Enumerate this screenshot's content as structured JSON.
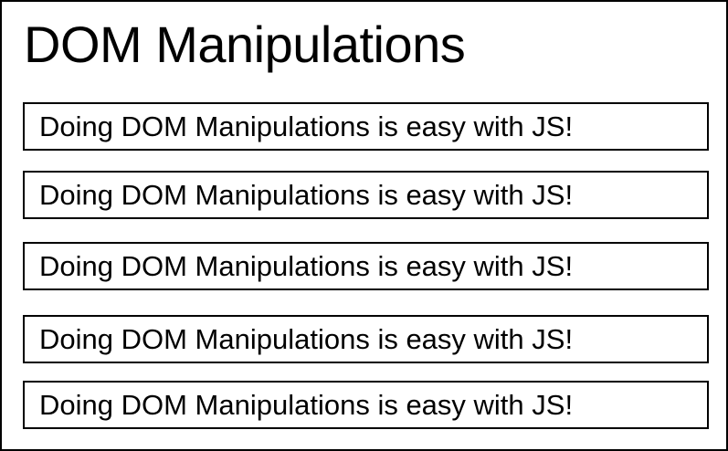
{
  "page": {
    "heading": "DOM Manipulations"
  },
  "paragraphs": [
    {
      "text": "Doing DOM Manipulations is easy with JS!"
    },
    {
      "text": "Doing DOM Manipulations is easy with JS!"
    },
    {
      "text": "Doing DOM Manipulations is easy with JS!"
    },
    {
      "text": "Doing DOM Manipulations is easy with JS!"
    },
    {
      "text": "Doing DOM Manipulations is easy with JS!"
    }
  ],
  "colors": {
    "background": "#ffffff",
    "border": "#000000",
    "text": "#000000"
  }
}
